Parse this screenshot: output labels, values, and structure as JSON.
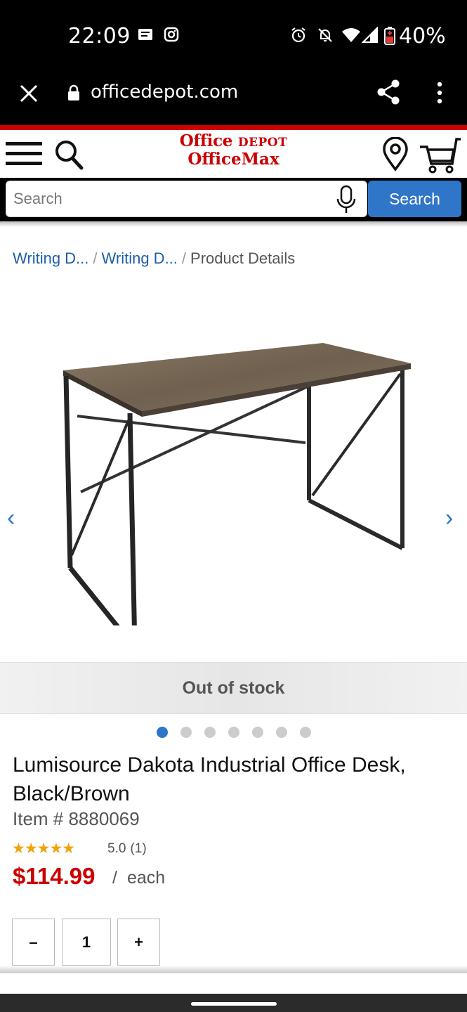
{
  "status_bar": {
    "time": "22:09",
    "battery_percent": "40%",
    "icons": [
      "message-icon",
      "instagram-icon",
      "alarm-icon",
      "mute-icon",
      "wifi-icon",
      "signal-icon",
      "battery-icon"
    ]
  },
  "browser": {
    "url": "officedepot.com",
    "icons": [
      "close-icon",
      "lock-icon",
      "share-icon",
      "more-vert-icon"
    ]
  },
  "header": {
    "logo_line1_a": "Office",
    "logo_line1_b": "DEPOT",
    "logo_line2": "OfficeMax",
    "brand_color": "#cc0000",
    "icons": [
      "hamburger-menu-icon",
      "search-icon",
      "location-pin-icon",
      "cart-icon"
    ]
  },
  "search": {
    "placeholder": "Search",
    "button_label": "Search",
    "button_color": "#2f75c8"
  },
  "breadcrumb": {
    "items": [
      "Writing D...",
      "Writing D..."
    ],
    "current": "Product Details"
  },
  "gallery": {
    "prev_label": "‹",
    "next_label": "›",
    "stock_status": "Out of stock",
    "image_count": 7,
    "active_index": 0
  },
  "product": {
    "title": "Lumisource Dakota Industrial Office Desk, Black/Brown",
    "item_number": "Item # 8880069",
    "stars": "★★★★★",
    "rating": "5.0",
    "review_count": "(1)",
    "price": "$114.99",
    "price_slash": "/",
    "price_unit": "each"
  },
  "quantity": {
    "minus_label": "–",
    "value": "1",
    "plus_label": "+"
  }
}
